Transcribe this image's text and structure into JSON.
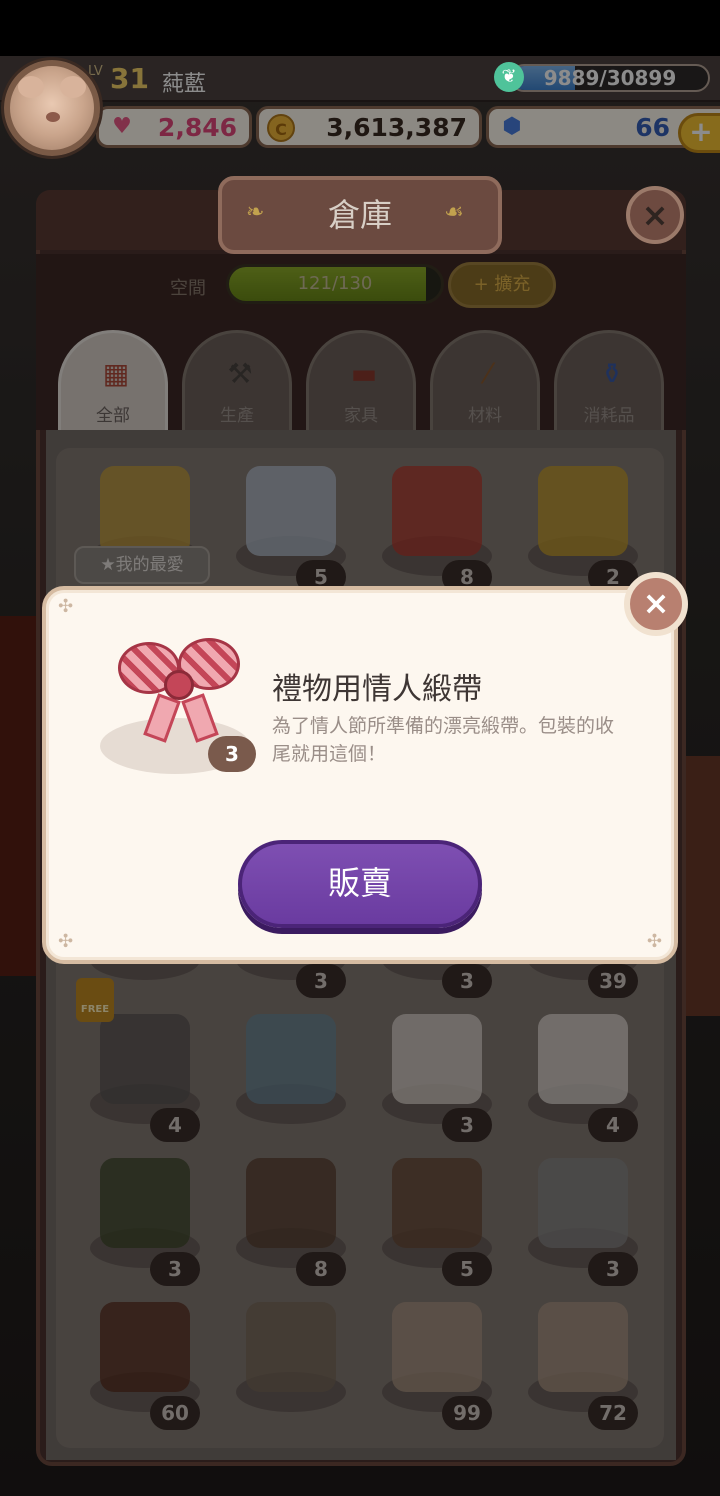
{
  "hud": {
    "level_label": "LV",
    "level": "31",
    "player_name": "蒓藍",
    "xp_text": "9889/30899",
    "xp_progress": 0.32,
    "hearts": "2,846",
    "coins": "3,613,387",
    "gems": "66",
    "plus": "+"
  },
  "warehouse": {
    "title": "倉庫",
    "close": "×",
    "space_label": "空間",
    "capacity_text": "121/130",
    "capacity_progress": 0.93,
    "expand_label": "+ 擴充",
    "favorite_tag": "★我的最愛",
    "free_badge": "FREE",
    "tabs": [
      {
        "label": "全部",
        "icon": "grid-icon"
      },
      {
        "label": "生產",
        "icon": "hammer-icon"
      },
      {
        "label": "家具",
        "icon": "sofa-icon"
      },
      {
        "label": "材料",
        "icon": "wood-icon"
      },
      {
        "label": "消耗品",
        "icon": "potion-icon"
      }
    ],
    "items": [
      {
        "icon": "cheese-icon",
        "count": ""
      },
      {
        "icon": "diamond-icon",
        "count": "5"
      },
      {
        "icon": "red-star-fruit-icon",
        "count": "8"
      },
      {
        "icon": "yellow-star-fruit-icon",
        "count": "2"
      },
      {
        "icon": "napkin-icon",
        "count": ""
      },
      {
        "icon": "ribbon-icon",
        "count": "3"
      },
      {
        "icon": "red-cloth-icon",
        "count": "3"
      },
      {
        "icon": "blue-glass-icon",
        "count": "39"
      },
      {
        "icon": "meat-tenderizer-icon",
        "count": "4"
      },
      {
        "icon": "spatula-ladle-icon",
        "count": ""
      },
      {
        "icon": "teacup-icon",
        "count": "3"
      },
      {
        "icon": "towel-icon",
        "count": "4"
      },
      {
        "icon": "frying-pan-icon",
        "count": "3"
      },
      {
        "icon": "jar-icon",
        "count": "8"
      },
      {
        "icon": "leather-strap-icon",
        "count": "5"
      },
      {
        "icon": "rolling-pin-icon",
        "count": "3"
      },
      {
        "icon": "chocolate-icon",
        "count": "60"
      },
      {
        "icon": "keyring-icon",
        "count": ""
      },
      {
        "icon": "fur-pelt-icon",
        "count": "99"
      },
      {
        "icon": "fur-pelt-icon",
        "count": "72"
      }
    ]
  },
  "modal": {
    "item_name": "禮物用情人緞帶",
    "item_desc": "為了情人節所準備的漂亮緞帶。包裝的收尾就用這個！",
    "item_count": "3",
    "sell_label": "販賣",
    "close": "×"
  },
  "colors": {
    "sell_button": "#6a3ba0",
    "modal_bg": "#fdf7ef",
    "heart": "#e4487c",
    "gem": "#3560b8"
  }
}
